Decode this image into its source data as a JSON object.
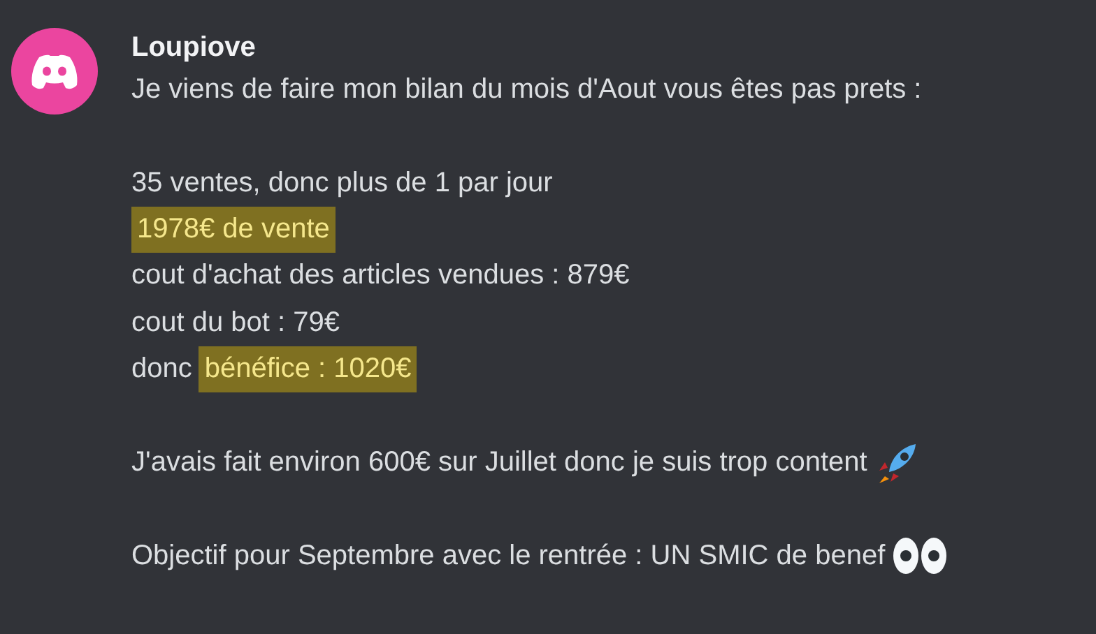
{
  "message": {
    "author": "Loupiove",
    "paragraphs": [
      {
        "lines": [
          {
            "segments": [
              {
                "text": "Je viens de faire mon bilan du mois d'Aout vous êtes pas prets :",
                "highlighted": false
              }
            ]
          }
        ]
      },
      {
        "lines": [
          {
            "segments": [
              {
                "text": "35 ventes, donc plus de 1 par jour",
                "highlighted": false
              }
            ]
          },
          {
            "segments": [
              {
                "text": "1978€ de vente",
                "highlighted": true
              }
            ]
          },
          {
            "segments": [
              {
                "text": "cout d'achat des articles vendues : 879€",
                "highlighted": false
              }
            ]
          },
          {
            "segments": [
              {
                "text": "cout du bot : 79€",
                "highlighted": false
              }
            ]
          },
          {
            "segments": [
              {
                "text": "donc",
                "highlighted": false
              },
              {
                "text": "bénéfice : 1020€",
                "highlighted": true
              }
            ]
          }
        ]
      },
      {
        "lines": [
          {
            "segments": [
              {
                "text": "J'avais fait environ 600€ sur Juillet donc je suis trop content",
                "highlighted": false
              }
            ],
            "trailing_icon": {
              "kind": "rocket"
            }
          }
        ]
      },
      {
        "lines": [
          {
            "segments": [
              {
                "text": "Objectif pour Septembre avec le rentrée : UN SMIC de benef",
                "highlighted": false
              }
            ],
            "trailing_icon": {
              "kind": "eyes"
            }
          }
        ]
      }
    ]
  }
}
